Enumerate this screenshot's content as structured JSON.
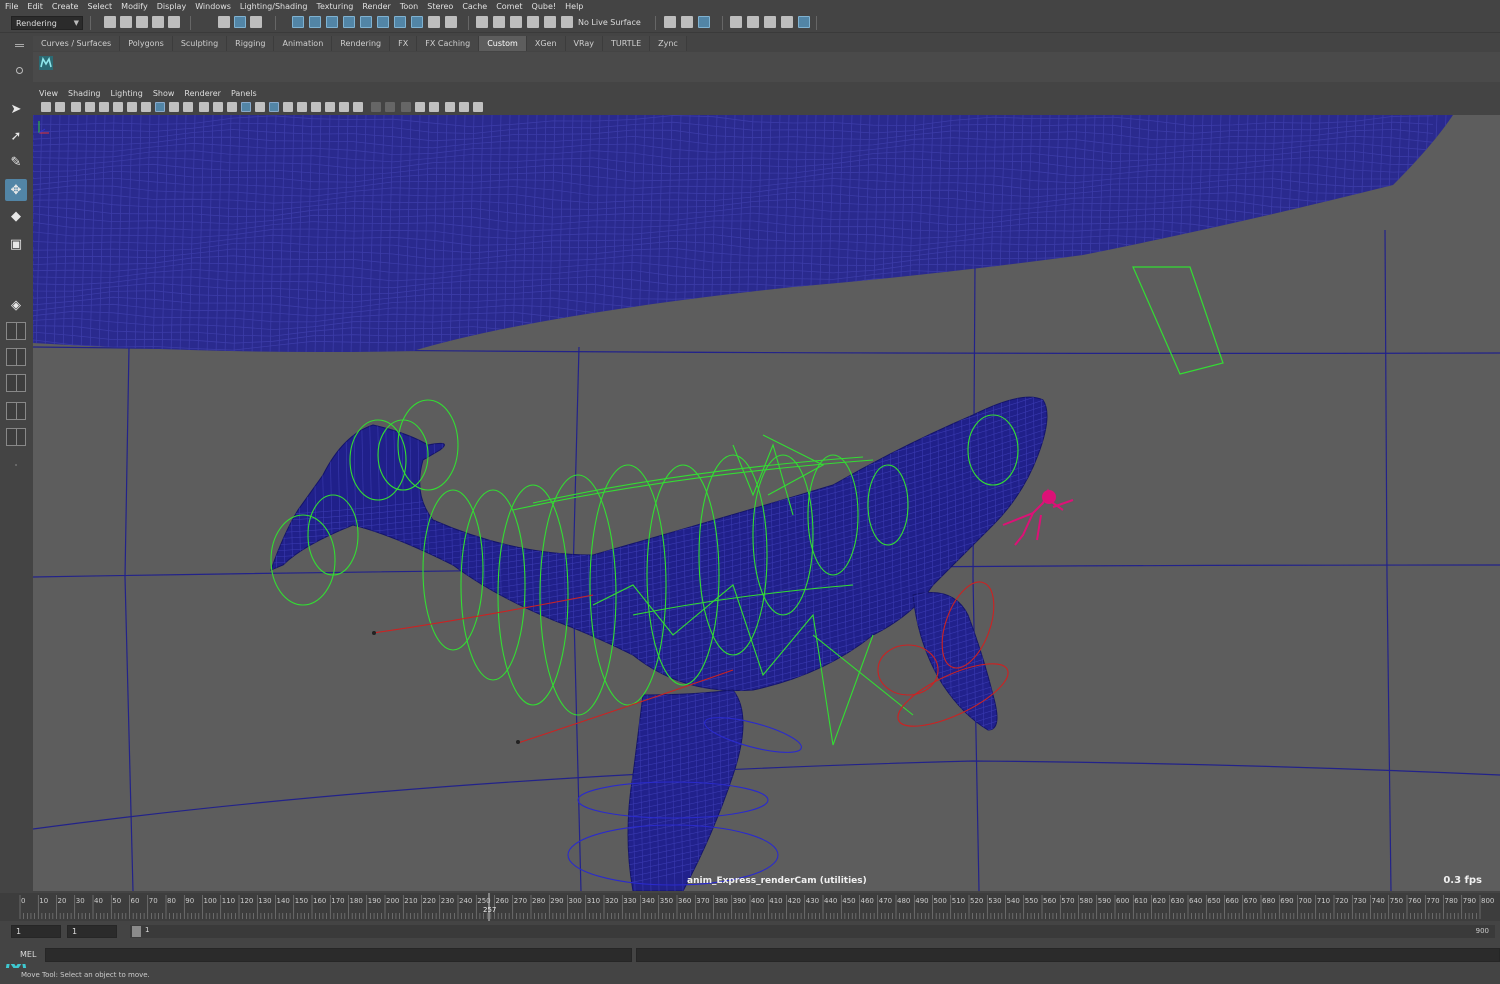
{
  "menubar": {
    "items": [
      "File",
      "Edit",
      "Create",
      "Select",
      "Modify",
      "Display",
      "Windows",
      "Lighting/Shading",
      "Texturing",
      "Render",
      "Toon",
      "Stereo",
      "Cache",
      "Comet",
      "Qube!",
      "Help"
    ]
  },
  "statusline": {
    "mode": "Rendering",
    "live_surface": "No Live Surface"
  },
  "shelf": {
    "tabs": [
      "Curves / Surfaces",
      "Polygons",
      "Sculpting",
      "Rigging",
      "Animation",
      "Rendering",
      "FX",
      "FX Caching",
      "Custom",
      "XGen",
      "VRay",
      "TURTLE",
      "Zync"
    ],
    "active_tab": "Custom"
  },
  "panel": {
    "menu": [
      "View",
      "Shading",
      "Lighting",
      "Show",
      "Renderer",
      "Panels"
    ],
    "camera_label": "anim_Express_renderCam (utilities)",
    "fps": "0.3 fps"
  },
  "timeline": {
    "ticks": [
      0,
      10,
      20,
      30,
      40,
      50,
      60,
      70,
      80,
      90,
      100,
      110,
      120,
      130,
      140,
      150,
      160,
      170,
      180,
      190,
      200,
      210,
      220,
      230,
      240,
      250,
      260,
      270,
      280,
      290,
      300,
      310,
      320,
      330,
      340,
      350,
      360,
      370,
      380,
      390,
      400,
      410,
      420,
      430,
      440,
      450,
      460,
      470,
      480,
      490,
      500,
      510,
      520,
      530,
      540,
      550,
      560,
      570,
      580,
      590,
      600,
      610,
      620,
      630,
      640,
      650,
      660,
      670,
      680,
      690,
      700,
      710,
      720,
      730,
      740,
      750,
      760,
      770,
      780,
      790,
      800
    ],
    "current_frame": "257"
  },
  "range": {
    "start": "1",
    "playback_start": "1",
    "slider_start": "1",
    "slider_end": "900"
  },
  "command": {
    "label": "MEL"
  },
  "help": {
    "text": "Move Tool: Select an object to move."
  },
  "colors": {
    "wire_blue": "#1c1c8c",
    "control_green": "#33dd33",
    "control_red": "#cc2222",
    "diver_magenta": "#dd1177",
    "accent": "#5285a6"
  }
}
